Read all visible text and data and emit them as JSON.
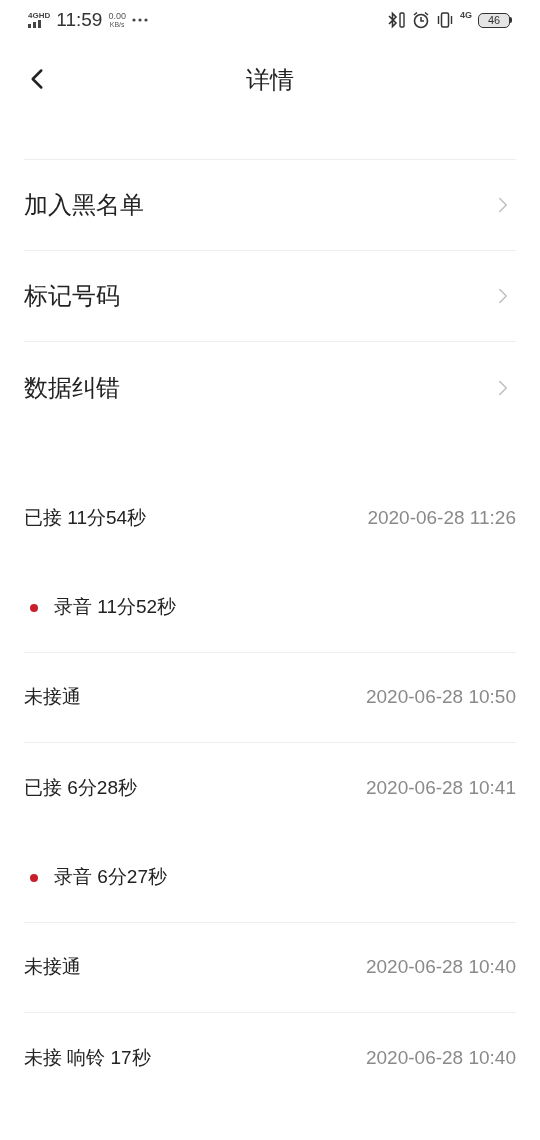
{
  "status_bar": {
    "network": "4GHD",
    "time": "11:59",
    "speed": "0.00",
    "speed_unit": "KB/s",
    "network_right": "4G",
    "battery": "46"
  },
  "header": {
    "title": "详情"
  },
  "menu_items": [
    {
      "label": "加入黑名单"
    },
    {
      "label": "标记号码"
    },
    {
      "label": "数据纠错"
    }
  ],
  "calls": [
    {
      "kind": "call",
      "label": "已接 11分54秒",
      "time": "2020-06-28 11:26"
    },
    {
      "kind": "recording",
      "label": "录音 11分52秒"
    },
    {
      "kind": "call",
      "label": "未接通",
      "time": "2020-06-28 10:50"
    },
    {
      "kind": "call",
      "label": "已接 6分28秒",
      "time": "2020-06-28 10:41"
    },
    {
      "kind": "recording",
      "label": "录音 6分27秒"
    },
    {
      "kind": "call",
      "label": "未接通",
      "time": "2020-06-28 10:40"
    },
    {
      "kind": "call",
      "label": "未接 响铃 17秒",
      "time": "2020-06-28 10:40"
    }
  ]
}
